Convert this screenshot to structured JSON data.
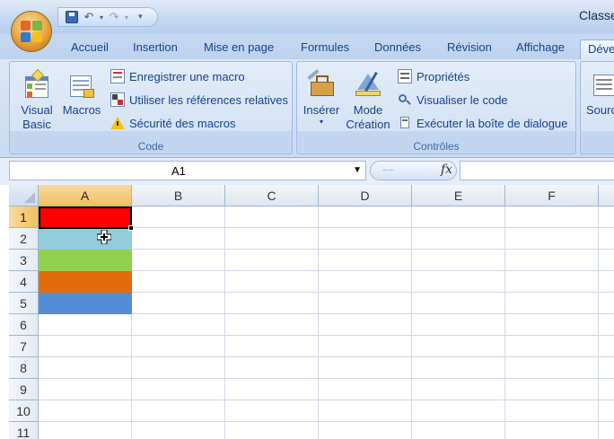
{
  "window": {
    "title": "Classe"
  },
  "quick_access": {
    "save_icon": "save-icon",
    "undo_icon": "undo-icon",
    "redo_icon": "redo-icon",
    "customize_icon": "customize-arrow-icon"
  },
  "tabs": [
    {
      "label": "Accueil"
    },
    {
      "label": "Insertion"
    },
    {
      "label": "Mise en page"
    },
    {
      "label": "Formules"
    },
    {
      "label": "Données"
    },
    {
      "label": "Révision"
    },
    {
      "label": "Affichage"
    },
    {
      "label": "Déve",
      "active": true
    }
  ],
  "ribbon": {
    "code_group": {
      "label": "Code",
      "visual_basic_line1": "Visual",
      "visual_basic_line2": "Basic",
      "macros": "Macros",
      "record_macro": "Enregistrer une macro",
      "relative_refs": "Utiliser les références relatives",
      "macro_security": "Sécurité des macros"
    },
    "controls_group": {
      "label": "Contrôles",
      "insert": "Insérer",
      "design_mode_line1": "Mode",
      "design_mode_line2": "Création",
      "properties": "Propriétés",
      "view_code": "Visualiser le code",
      "run_dialog": "Exécuter la boîte de dialogue"
    },
    "source_group": {
      "source": "Sourc"
    }
  },
  "formula_bar": {
    "name_box": "A1",
    "fx_label": "fx",
    "formula": ""
  },
  "sheet": {
    "columns": [
      "A",
      "B",
      "C",
      "D",
      "E",
      "F"
    ],
    "rows": [
      "1",
      "2",
      "3",
      "4",
      "5",
      "6",
      "7",
      "8",
      "9",
      "10",
      "11"
    ],
    "selected_cell": "A1",
    "filled_cells": [
      {
        "ref": "A1",
        "color": "#ff0000"
      },
      {
        "ref": "A2",
        "color": "#92cddc"
      },
      {
        "ref": "A3",
        "color": "#92d050"
      },
      {
        "ref": "A4",
        "color": "#e36c0a"
      },
      {
        "ref": "A5",
        "color": "#538dd5"
      }
    ]
  },
  "colors": {
    "ribbon": "#c9dbf2",
    "tab_text": "#15428b",
    "header_selected": "#f1c15f",
    "gridline": "#d0d7e5"
  }
}
